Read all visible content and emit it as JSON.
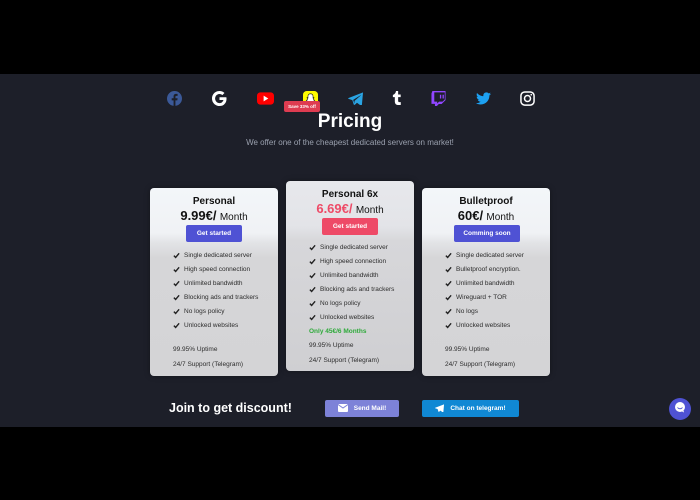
{
  "social": [
    {
      "name": "facebook",
      "color": "#3b5998"
    },
    {
      "name": "google",
      "color": "#ffffff"
    },
    {
      "name": "youtube",
      "color": "#ff0000"
    },
    {
      "name": "snapchat",
      "color": "#fffc00"
    },
    {
      "name": "telegram",
      "color": "#2aa4e3"
    },
    {
      "name": "tumblr",
      "color": "#ffffff"
    },
    {
      "name": "twitch",
      "color": "#9146ff"
    },
    {
      "name": "twitter",
      "color": "#1da1f2"
    },
    {
      "name": "instagram",
      "color": "#ffffff"
    }
  ],
  "header": {
    "title": "Pricing",
    "subtitle": "We offer one of the cheapest dedicated servers on market!"
  },
  "plans": [
    {
      "name": "Personal",
      "price": "9.99€/",
      "unit": "Month",
      "button": "Get started",
      "features": [
        "Single dedicated server",
        "High speed connection",
        "Unlimited bandwidth",
        "Blocking ads and trackers",
        "No logs policy",
        "Unlocked websites"
      ],
      "uptime": "99.95% Uptime",
      "support": "24/7 Support (Telegram)"
    },
    {
      "name": "Personal 6x",
      "price": "6.69€/",
      "unit": "Month",
      "button": "Get started",
      "badge": "Save 33% off",
      "features": [
        "Single dedicated server",
        "High speed connection",
        "Unlimited bandwidth",
        "Blocking ads and trackers",
        "No logs policy",
        "Unlocked websites"
      ],
      "promo": "Only 45€/6 Months",
      "uptime": "99.95% Uptime",
      "support": "24/7 Support (Telegram)"
    },
    {
      "name": "Bulletproof",
      "price": "60€/",
      "unit": "Month",
      "button": "Comming soon",
      "features": [
        "Single dedicated server",
        "Bulletproof encryption.",
        "Unlimited bandwidth",
        "Wireguard + TOR",
        "No logs",
        "Unlocked websites"
      ],
      "uptime": "99.95% Uptime",
      "support": "24/7 Support (Telegram)"
    }
  ],
  "footer": {
    "join": "Join to get discount!",
    "mail_button": "Send Mail!",
    "telegram_button": "Chat on telegram!"
  },
  "colors": {
    "accent": "#4f52d4",
    "highlight": "#ee4a67",
    "promo": "#2eaa3a",
    "background": "#1d1f29"
  }
}
